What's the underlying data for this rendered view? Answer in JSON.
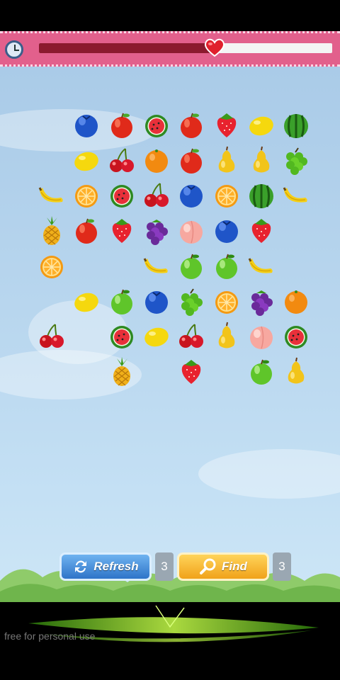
{
  "header": {
    "timer_icon": "stopwatch-icon",
    "progress": 0.6,
    "progress_color": "#8b1a2e",
    "heart_icon": "heart-icon"
  },
  "board": {
    "columns": 8,
    "grid": [
      [
        "",
        "blueberry",
        "apple",
        "watermelon",
        "apple",
        "strawberry",
        "lemon",
        "watermelon-whole"
      ],
      [
        "",
        "lemon",
        "cherry",
        "orange",
        "apple",
        "pear",
        "pear",
        "grapes-green"
      ],
      [
        "banana",
        "orange-slice",
        "watermelon",
        "cherry",
        "blueberry",
        "orange-slice",
        "watermelon-whole",
        "banana"
      ],
      [
        "pineapple",
        "apple",
        "strawberry",
        "grapes-purple",
        "peach",
        "blueberry",
        "strawberry",
        ""
      ],
      [
        "orange-slice",
        "",
        "",
        "banana",
        "green-apple",
        "green-apple",
        "banana",
        ""
      ],
      [
        "",
        "lemon",
        "green-apple",
        "blueberry",
        "grapes-green",
        "orange-slice",
        "grapes-purple",
        "orange"
      ],
      [
        "cherry",
        "",
        "watermelon",
        "lemon",
        "cherry",
        "pear",
        "peach",
        "watermelon"
      ],
      [
        "",
        "",
        "pineapple",
        "",
        "strawberry",
        "",
        "green-apple",
        "pear"
      ]
    ]
  },
  "controls": {
    "refresh_label": "Refresh",
    "refresh_icon": "refresh-icon",
    "refresh_count": "3",
    "find_label": "Find",
    "find_icon": "magnifier-icon",
    "find_count": "3"
  },
  "ad": {
    "text": "free for personal use"
  }
}
